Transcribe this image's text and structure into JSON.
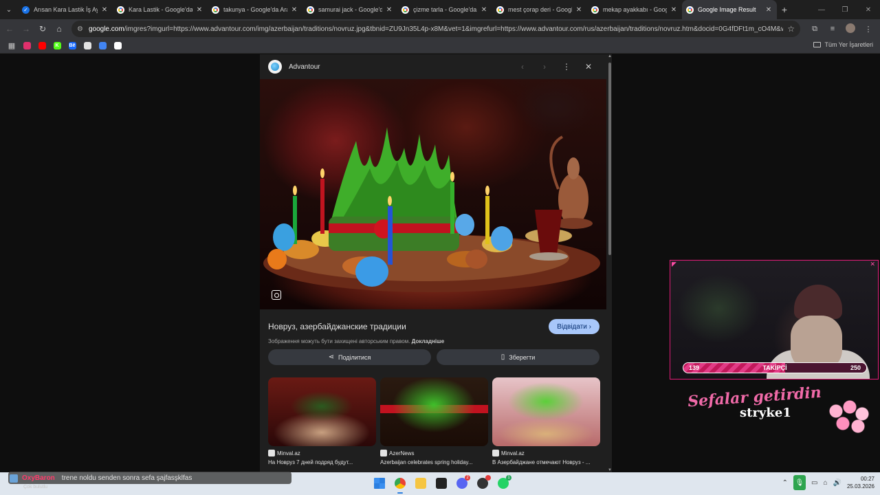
{
  "tabs": [
    {
      "label": "Arısan Kara Lastik İş Ayakka",
      "icon": "check-favicon",
      "active": false
    },
    {
      "label": "Kara Lastik - Google'da Ara",
      "icon": "google-favicon",
      "active": false
    },
    {
      "label": "takunya - Google'da Ara",
      "icon": "google-favicon",
      "active": false
    },
    {
      "label": "samurai jack - Google'da Ara",
      "icon": "google-favicon",
      "active": false
    },
    {
      "label": "çizme tarla - Google'da Ara",
      "icon": "google-favicon",
      "active": false
    },
    {
      "label": "mest çorap deri - Google'da",
      "icon": "google-favicon",
      "active": false
    },
    {
      "label": "mekap ayakkabı - Google'da",
      "icon": "google-favicon",
      "active": false
    },
    {
      "label": "Google Image Result",
      "icon": "google-favicon",
      "active": true
    }
  ],
  "address": {
    "host": "google.com",
    "path": "/imgres?imgurl=https://www.advantour.com/img/azerbaijan/traditions/novruz.jpg&tbnid=ZU9Jn35L4p-x8M&vet=1&imgrefurl=https://www.advantour.com/rus/azerbaijan/traditions/novruz.htm&docid=0G4fDFt1m_cO4M&w=900..."
  },
  "bookmarks": {
    "items": [
      {
        "name": "instagram",
        "color": "#e1306c",
        "glyph": ""
      },
      {
        "name": "youtube",
        "color": "#ff0000",
        "glyph": ""
      },
      {
        "name": "kick",
        "color": "#53fc18",
        "glyph": "K"
      },
      {
        "name": "behance",
        "color": "#1769ff",
        "glyph": "Bē"
      },
      {
        "name": "chatgpt",
        "color": "#e3e3e3",
        "glyph": ""
      },
      {
        "name": "translate",
        "color": "#4285f4",
        "glyph": ""
      },
      {
        "name": "cloud",
        "color": "#ffffff",
        "glyph": ""
      }
    ],
    "all_label": "Tüm Yer İşaretleri"
  },
  "panel": {
    "site_name": "Advantour",
    "title": "Новруз, азербайджанские традиции",
    "visit_label": "Відвідати",
    "copyright_text": "Зображення можуть бути захищені авторським правом.",
    "copyright_link": "Докладніше",
    "share_label": "Поділитися",
    "save_label": "Зберегти",
    "related": [
      {
        "source": "Minval.az",
        "caption": "На Новруз 7 дней подряд будут..."
      },
      {
        "source": "AzerNews",
        "caption": "Azerbaijan celebrates spring holiday..."
      },
      {
        "source": "Minval.az",
        "caption": "В Азербайджане отмечают Новруз - ..."
      }
    ]
  },
  "overlay": {
    "follow_current": "139",
    "follow_label": "TAKİPÇİ",
    "follow_goal": "250",
    "follow_progress": 0.556,
    "welcome_line": "Sefalar getirdin",
    "welcome_user": "stryke1"
  },
  "notification": {
    "user": "OxyBaron",
    "message": "trene noldu senden sonra sefa şajfasşklfas",
    "sub": "Çok bulutlu"
  },
  "taskbar": {
    "discord_badge": "2",
    "whatsapp_badge": "1",
    "time": "00:27",
    "date": "25.03.2026"
  },
  "colors": {
    "accent": "#a8c7fa",
    "overlay_pink": "#e31c79",
    "chat_user": "#ff3b6b"
  }
}
